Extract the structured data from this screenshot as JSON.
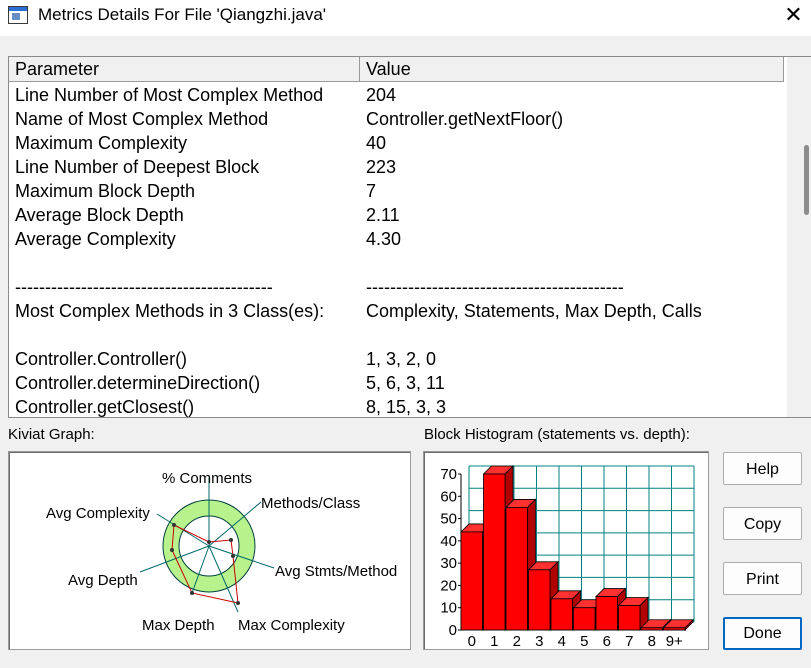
{
  "window": {
    "title": "Metrics Details For File 'Qiangzhi.java'",
    "close_glyph": "✕"
  },
  "table": {
    "headers": [
      "Parameter",
      "Value"
    ],
    "rows": [
      {
        "param": "Line Number of Most Complex Method",
        "value": "204"
      },
      {
        "param": "Name of Most Complex Method",
        "value": "Controller.getNextFloor()"
      },
      {
        "param": "Maximum Complexity",
        "value": "40"
      },
      {
        "param": "Line Number of Deepest Block",
        "value": "223"
      },
      {
        "param": "Maximum Block Depth",
        "value": "7"
      },
      {
        "param": "Average Block Depth",
        "value": "2.11"
      },
      {
        "param": "Average Complexity",
        "value": "4.30"
      },
      {
        "param": "",
        "value": ""
      },
      {
        "param": "-------------------------------------------",
        "value": "-------------------------------------------"
      },
      {
        "param": "Most Complex Methods in 3 Class(es):",
        "value": "Complexity, Statements, Max Depth, Calls"
      },
      {
        "param": "",
        "value": ""
      },
      {
        "param": "Controller.Controller()",
        "value": "1, 3, 2, 0"
      },
      {
        "param": "Controller.determineDirection()",
        "value": "5, 6, 3, 11"
      },
      {
        "param": "Controller.getClosest()",
        "value": "8, 15, 3, 3"
      }
    ]
  },
  "kiviat": {
    "label": "Kiviat Graph:",
    "axes": [
      "% Comments",
      "Methods/Class",
      "Avg Stmts/Method",
      "Max Complexity",
      "Max Depth",
      "Avg Depth",
      "Avg Complexity"
    ],
    "colors": {
      "ring": "#b8f28c",
      "inner": "#ffffff",
      "polygon": "#cc0000",
      "spokes": "#006a6a"
    }
  },
  "histogram": {
    "label": "Block Histogram (statements vs. depth):",
    "colors": {
      "bar": "#ff0000",
      "grid": "#008080"
    }
  },
  "chart_data": {
    "type": "bar",
    "title": "Block Histogram (statements vs. depth):",
    "categories": [
      "0",
      "1",
      "2",
      "3",
      "4",
      "5",
      "6",
      "7",
      "8",
      "9+"
    ],
    "values": [
      44,
      70,
      55,
      27,
      14,
      10,
      15,
      11,
      1,
      1
    ],
    "ylim": [
      0,
      70
    ],
    "yticks": [
      0,
      10,
      20,
      30,
      40,
      50,
      60,
      70
    ],
    "grid": true
  },
  "buttons": {
    "help": "Help",
    "copy": "Copy",
    "print": "Print",
    "done": "Done"
  }
}
